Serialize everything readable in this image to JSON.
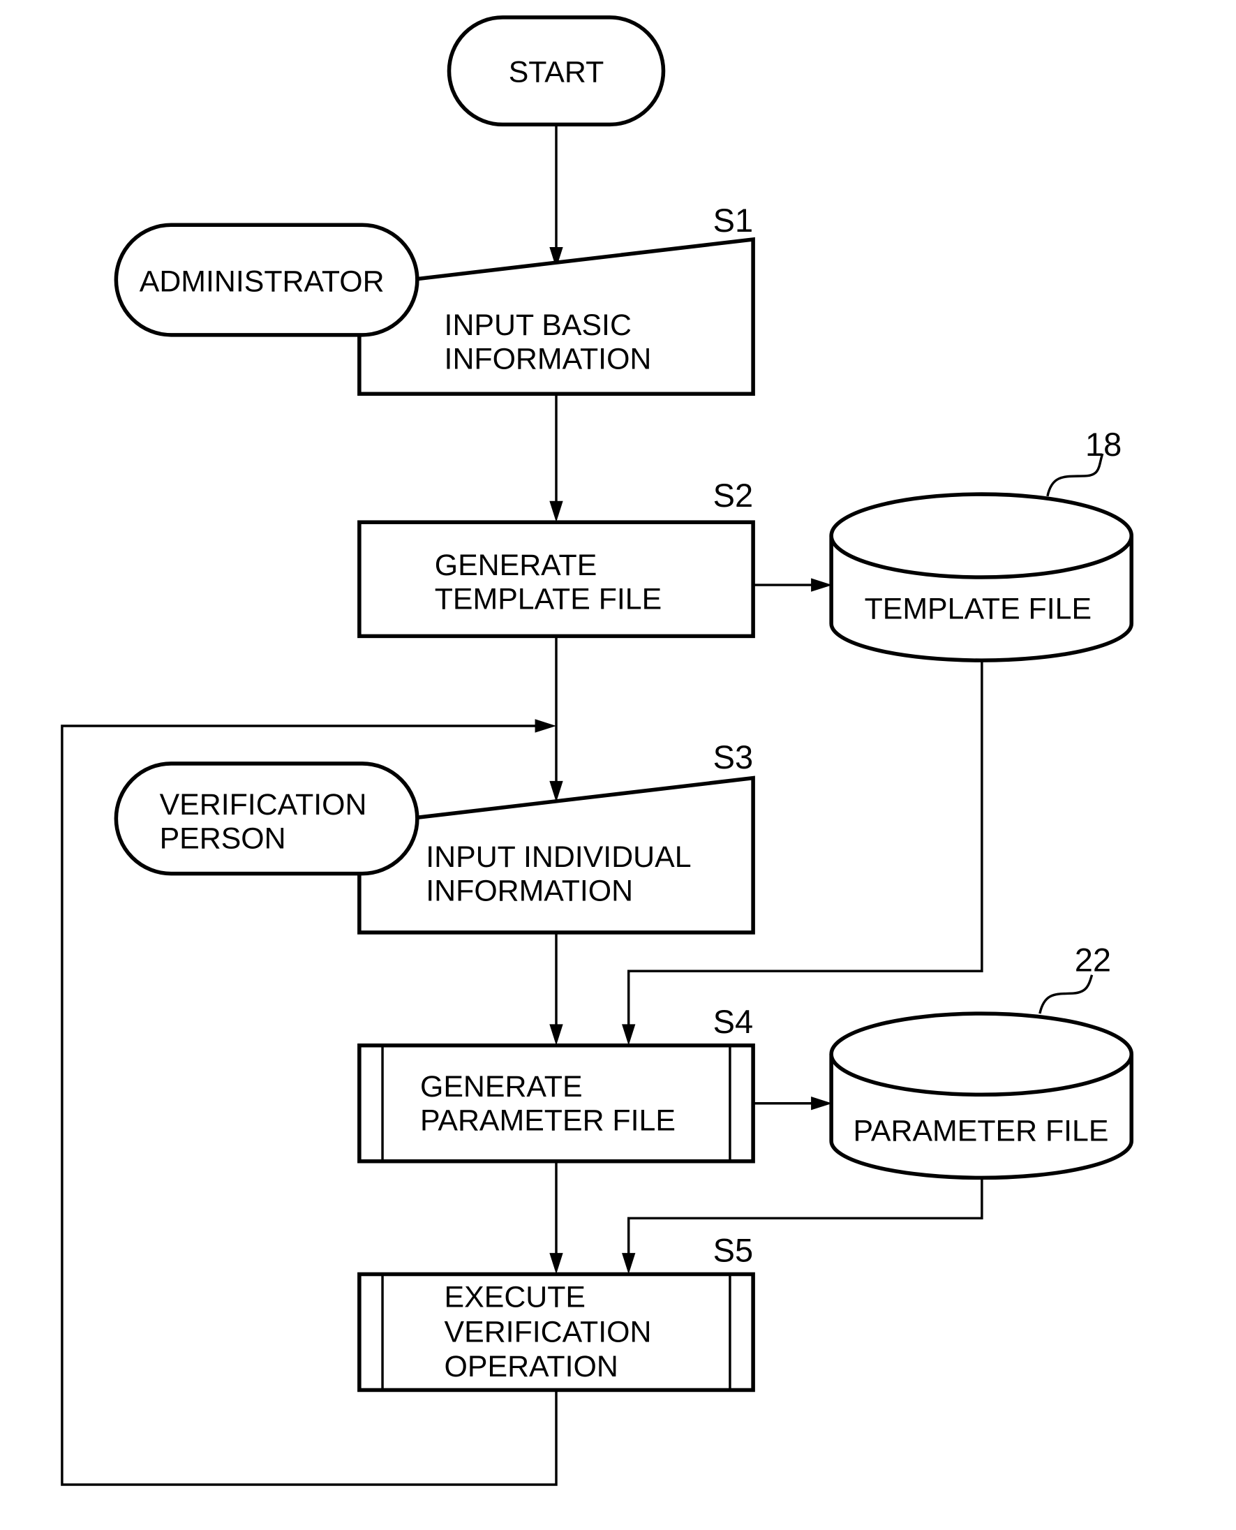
{
  "diagram": {
    "type": "flowchart",
    "nodes": {
      "start": {
        "label": "START",
        "shape": "terminator"
      },
      "administrator": {
        "label": "ADMINISTRATOR",
        "shape": "terminator"
      },
      "s1": {
        "step": "S1",
        "lines": [
          "INPUT BASIC",
          "INFORMATION"
        ],
        "shape": "manual-input"
      },
      "s2": {
        "step": "S2",
        "lines": [
          "GENERATE",
          "TEMPLATE FILE"
        ],
        "shape": "process"
      },
      "template_file": {
        "ref": "18",
        "label": "TEMPLATE FILE",
        "shape": "database"
      },
      "verification_person": {
        "lines": [
          "VERIFICATION",
          "PERSON"
        ],
        "shape": "terminator"
      },
      "s3": {
        "step": "S3",
        "lines": [
          "INPUT INDIVIDUAL",
          "INFORMATION"
        ],
        "shape": "manual-input"
      },
      "s4": {
        "step": "S4",
        "lines": [
          "GENERATE",
          "PARAMETER FILE"
        ],
        "shape": "predefined-process"
      },
      "parameter_file": {
        "ref": "22",
        "label": "PARAMETER FILE",
        "shape": "database"
      },
      "s5": {
        "step": "S5",
        "lines": [
          "EXECUTE",
          "VERIFICATION",
          "OPERATION"
        ],
        "shape": "predefined-process"
      }
    },
    "edges": [
      {
        "from": "start",
        "to": "s1"
      },
      {
        "from": "s1",
        "to": "s2"
      },
      {
        "from": "s2",
        "to": "template_file"
      },
      {
        "from": "s2",
        "to": "s3"
      },
      {
        "from": "template_file",
        "to": "s4"
      },
      {
        "from": "s3",
        "to": "s4"
      },
      {
        "from": "s4",
        "to": "parameter_file"
      },
      {
        "from": "s4",
        "to": "s5"
      },
      {
        "from": "parameter_file",
        "to": "s5"
      },
      {
        "from": "s5",
        "to": "s3",
        "note": "loop back"
      }
    ]
  }
}
